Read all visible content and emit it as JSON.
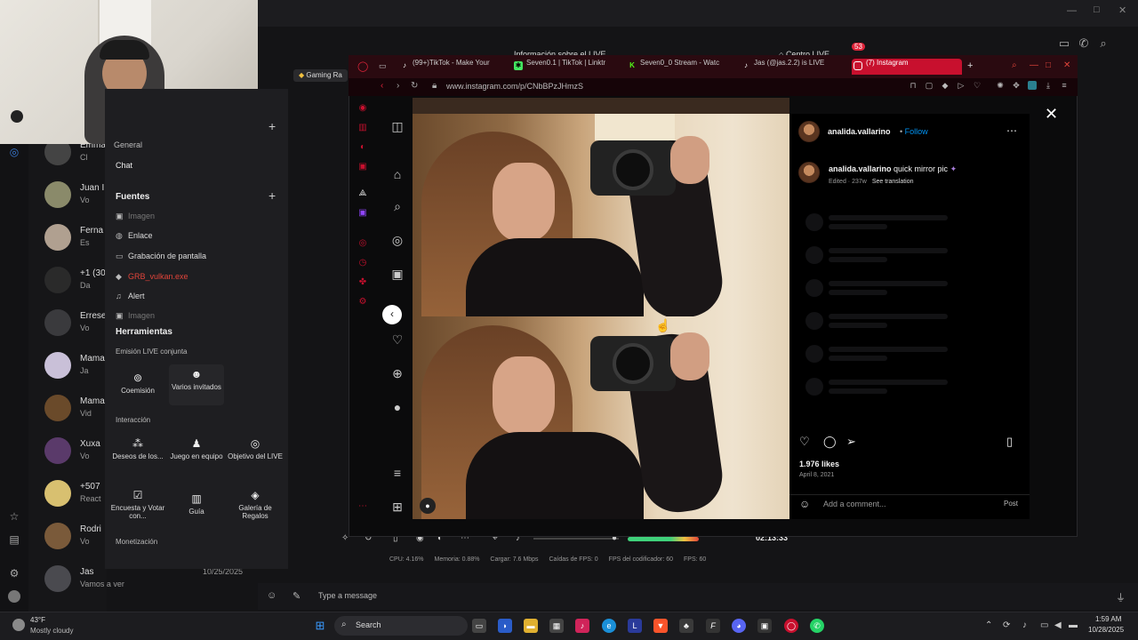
{
  "desktop": {
    "live_window_title": "Información sobre el LIVE",
    "chat_list": [
      {
        "name": "Emma",
        "preview": "Cl"
      },
      {
        "name": "Juan I",
        "preview": "Vo"
      },
      {
        "name": "Ferna",
        "preview": "Es"
      },
      {
        "name": "+1 (30",
        "preview": "Da"
      },
      {
        "name": "Errese",
        "preview": "Vo"
      },
      {
        "name": "Mama",
        "preview": "Ja"
      },
      {
        "name": "Mama",
        "preview": "Vid"
      },
      {
        "name": "Xuxa",
        "preview": "Vo"
      },
      {
        "name": "+507",
        "preview": "React"
      },
      {
        "name": "Rodri",
        "preview": "Vo"
      },
      {
        "name": "Jas",
        "preview": "Vamos a ver"
      }
    ],
    "last_chat_date": "10/25/2025",
    "composer_placeholder": "Type a message"
  },
  "studio": {
    "gaming_tab": "Gaming Ra",
    "general_label": "General",
    "chat_label": "Chat",
    "sources_title": "Fuentes",
    "sources": [
      {
        "label": "Imagen",
        "icon": "image-icon",
        "dim": true
      },
      {
        "label": "Enlace",
        "icon": "globe-icon",
        "dim": false
      },
      {
        "label": "Grabación de pantalla",
        "icon": "monitor-icon",
        "dim": false
      },
      {
        "label": "GRB_vulkan.exe",
        "icon": "game-icon",
        "dim": false,
        "red": true
      },
      {
        "label": "Alert",
        "icon": "bell-icon",
        "dim": false
      },
      {
        "label": "Imagen",
        "icon": "image-icon",
        "dim": true
      }
    ],
    "tools_title": "Herramientas",
    "joint_title": "Emisión LIVE conjunta",
    "joint_tools": [
      {
        "label": "Coemisión",
        "icon": "link-icon"
      },
      {
        "label": "Varios invitados",
        "icon": "people-icon"
      }
    ],
    "interaction_title": "Interacción",
    "interaction_tools": [
      {
        "label": "Deseos de los...",
        "icon": "wish-icon"
      },
      {
        "label": "Juego en equipo",
        "icon": "team-icon"
      },
      {
        "label": "Objetivo del LIVE",
        "icon": "target-icon"
      },
      {
        "label": "Encuesta y Votar con...",
        "icon": "poll-icon"
      },
      {
        "label": "Guía",
        "icon": "guide-icon"
      },
      {
        "label": "Galería de Regalos",
        "icon": "gift-icon"
      }
    ],
    "monetization_title": "Monetización",
    "timer": "02:13:33",
    "stats": {
      "cpu": "CPU: 4.16%",
      "memory": "Memoria: 0.88%",
      "load": "Cargar: 7.6 Mbps",
      "fps_drops": "Caídas de FPS: 0",
      "encoder_fps": "FPS del codificador: 60",
      "fps": "FPS: 60"
    },
    "live_center": "Centro LIVE",
    "notif_count": "53"
  },
  "browser": {
    "tabs": [
      {
        "label": "(99+)TikTok - Make Your",
        "icon": "tiktok-icon"
      },
      {
        "label": "Seven0.1 | TikTok | Linktr",
        "icon": "linktree-icon"
      },
      {
        "label": "Seven0_0 Stream - Watc",
        "icon": "kick-icon"
      },
      {
        "label": "Jas (@jas.2.2) is LIVE",
        "icon": "tiktok-icon"
      },
      {
        "label": "(7) Instagram",
        "icon": "instagram-icon",
        "active": true
      }
    ],
    "url": "www.instagram.com/p/CNbBPzJHmzS",
    "accent": "#c8102e"
  },
  "instagram": {
    "username": "analida.vallarino",
    "follow": "Follow",
    "caption_user": "analida.vallarino",
    "caption_text": "quick mirror pic",
    "edited": "Edited · 237w",
    "see_translation": "See translation",
    "likes": "1.976 likes",
    "date": "April 8, 2021",
    "comment_placeholder": "Add a comment...",
    "post_label": "Post"
  },
  "taskbar": {
    "temp": "43°F",
    "weather": "Mostly cloudy",
    "search": "Search",
    "time": "1:59 AM",
    "date": "10/28/2025"
  }
}
